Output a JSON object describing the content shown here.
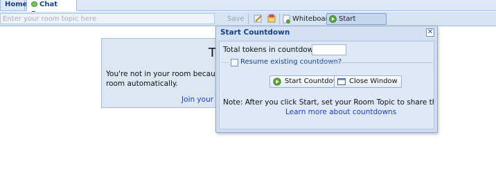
{
  "tabs": [
    {
      "label": "Home"
    },
    {
      "label": "Chat Room",
      "icon": "chat-bubble-icon"
    }
  ],
  "toolbar": {
    "topic_placeholder": "Enter your room topic here",
    "save_label": "Save",
    "whiteboard_label": "Whiteboard",
    "start_countdown_label": "Start Countdown"
  },
  "notice": {
    "title_fragment": "Th",
    "message": "You're not in your room because you",
    "message_line2": "room automatically.",
    "join_link": "Join your ro"
  },
  "dialog": {
    "title": "Start Countdown",
    "close_glyph": "✕",
    "tokens_label": "Total tokens in countdown:",
    "tokens_value": "",
    "resume_label": "Resume existing countdown?",
    "start_button": "Start Countdown",
    "close_button": "Close Window",
    "note": "Note: After you click Start, set your Room Topic to share the countdow",
    "learn_link": "Learn more about countdowns"
  },
  "colors": {
    "tab_text": "#15428b",
    "link": "#1a3fcf",
    "panel_bg": "#dfe8f6"
  }
}
